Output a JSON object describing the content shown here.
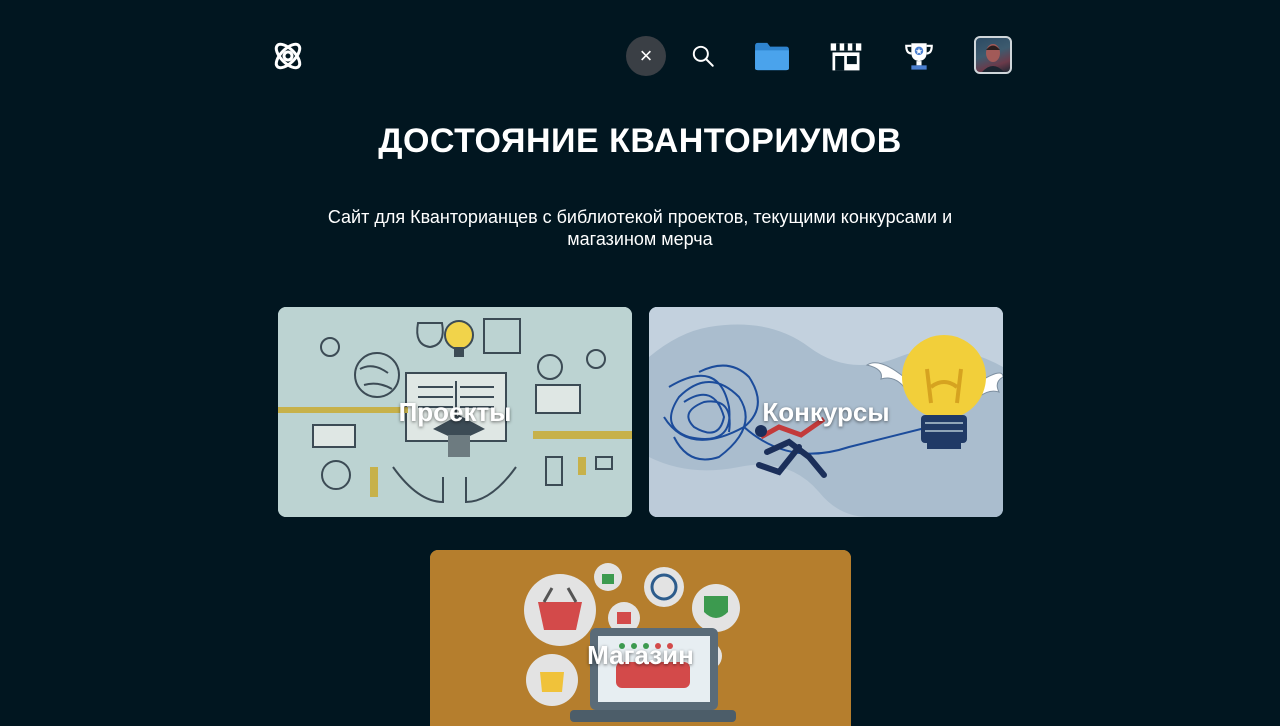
{
  "header": {
    "logo_icon": "atom-logo-icon",
    "nav": [
      {
        "name": "close-icon",
        "glyph": "×"
      },
      {
        "name": "search-icon"
      },
      {
        "name": "folder-icon"
      },
      {
        "name": "shop-icon"
      },
      {
        "name": "trophy-icon"
      },
      {
        "name": "avatar"
      }
    ]
  },
  "main": {
    "title": "ДОСТОЯНИЕ КВАНТОРИУМОВ",
    "subtitle_line1": "Сайт для Кванторианцев с библиотекой проектов, текущими конкурсами и",
    "subtitle_line2": "магазином мерча",
    "cards": [
      {
        "label": "Проекты",
        "color": "#b9cfd0"
      },
      {
        "label": "Конкурсы",
        "color": "#a9bccd"
      },
      {
        "label": "Магазин",
        "color": "#b57e2d"
      }
    ]
  },
  "colors": {
    "background": "#011620",
    "accent_blue": "#4a9be0",
    "bulb_yellow": "#f2cf3a"
  }
}
